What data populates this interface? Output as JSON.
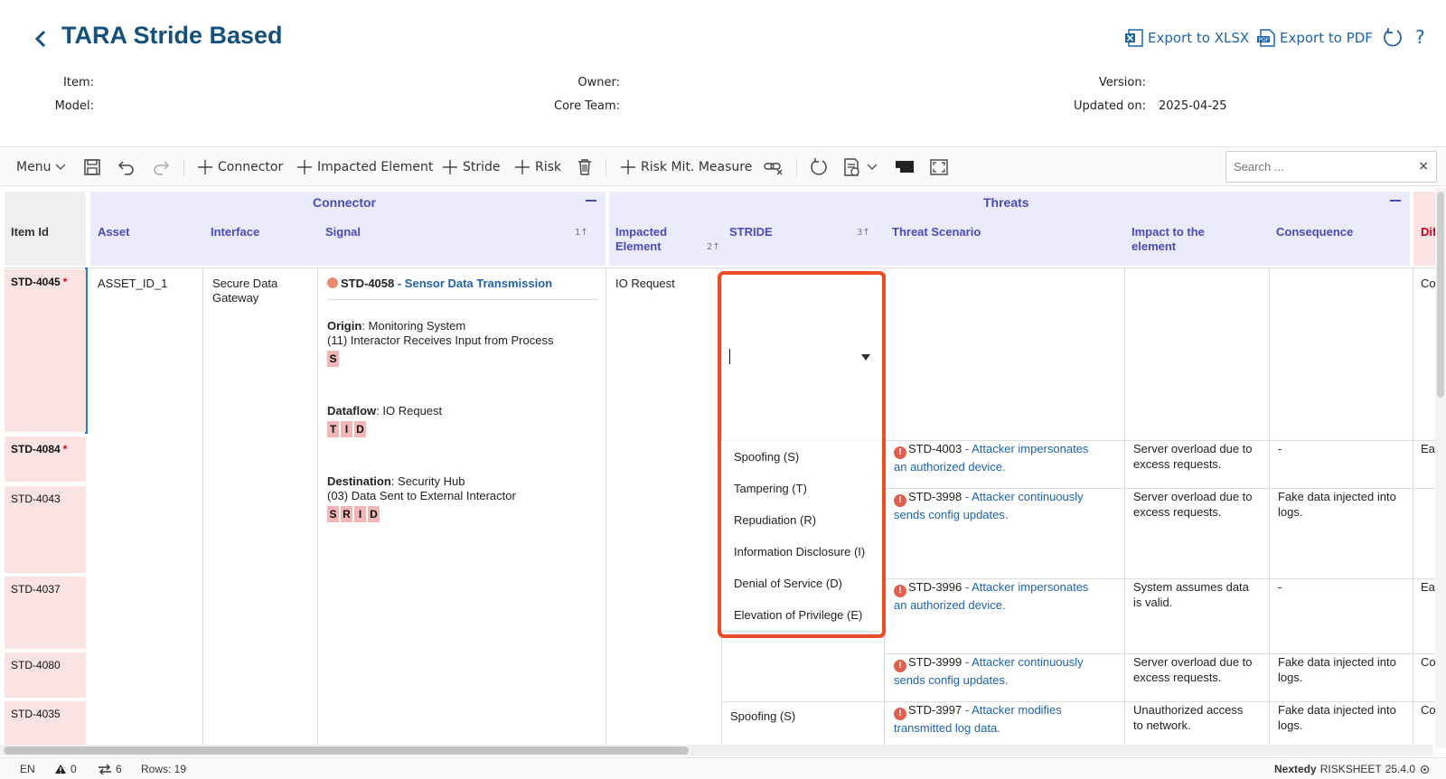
{
  "header": {
    "title": "TARA Stride Based",
    "export_xlsx": "Export to XLSX",
    "export_pdf": "Export to PDF",
    "help": "?"
  },
  "meta": {
    "item_label": "Item:",
    "model_label": "Model:",
    "owner_label": "Owner:",
    "core_team_label": "Core Team:",
    "version_label": "Version:",
    "updated_label": "Updated on:",
    "updated_value": "2025-04-25"
  },
  "toolbar": {
    "menu": "Menu",
    "connector": "Connector",
    "impacted_element": "Impacted Element",
    "stride": "Stride",
    "risk": "Risk",
    "risk_mit_measure": "Risk Mit. Measure",
    "search_placeholder": "Search ..."
  },
  "groups": {
    "connector": "Connector",
    "threats": "Threats"
  },
  "columns": {
    "item_id": "Item Id",
    "asset": "Asset",
    "interface": "Interface",
    "signal": "Signal",
    "signal_sort": "1↑",
    "impacted_element_1": "Impacted",
    "impacted_element_2": "Element",
    "impacted_sort": "2↑",
    "stride": "STRIDE",
    "stride_sort": "3↑",
    "threat_scenario": "Threat Scenario",
    "impact_1": "Impact to the",
    "impact_2": "element",
    "consequence": "Consequence",
    "difficulty": "Dif"
  },
  "rows": {
    "id_1": "STD-4045",
    "id_2": "STD-4084",
    "id_3": "STD-4043",
    "id_4": "STD-4037",
    "id_5": "STD-4080",
    "id_6": "STD-4035",
    "asset": "ASSET_ID_1",
    "interface_1": "Secure Data",
    "interface_2": "Gateway",
    "signal_id": "STD-4058",
    "signal_name": " - Sensor Data Transmission",
    "origin_label": "Origin",
    "origin_value": ": Monitoring System",
    "origin_detail": "(11) Interactor Receives Input from Process",
    "origin_badges": [
      "S"
    ],
    "dataflow_label": "Dataflow",
    "dataflow_value": ": IO Request",
    "dataflow_badges": [
      "T",
      "I",
      "D"
    ],
    "dest_label": "Destination",
    "dest_value": ": Security Hub",
    "dest_detail": "(03) Data Sent to External Interactor",
    "dest_badges": [
      "S",
      "R",
      "I",
      "D"
    ],
    "impacted": "IO Request",
    "stride_last": "Spoofing (S)",
    "difficulty_1": "Co",
    "threats": [
      {
        "id": "STD-4003",
        "text_1": " - Attacker impersonates",
        "text_2": "an authorized device.",
        "impact_1": "Server overload due to",
        "impact_2": "excess requests.",
        "consequence_1": "-",
        "consequence_2": "",
        "difficulty": "Eas"
      },
      {
        "id": "STD-3998",
        "text_1": " - Attacker continuously",
        "text_2": "sends config updates.",
        "impact_1": "Server overload due to",
        "impact_2": "excess requests.",
        "consequence_1": "Fake data injected into",
        "consequence_2": "logs.",
        "difficulty": ""
      },
      {
        "id": "STD-3996",
        "text_1": " - Attacker impersonates",
        "text_2": "an authorized device.",
        "impact_1": "System assumes data",
        "impact_2": "is valid.",
        "consequence_1": "-",
        "consequence_2": "",
        "difficulty": "Eas"
      },
      {
        "id": "STD-3999",
        "text_1": " - Attacker continuously",
        "text_2": "sends config updates.",
        "impact_1": "Server overload due to",
        "impact_2": "excess requests.",
        "consequence_1": "Fake data injected into",
        "consequence_2": "logs.",
        "difficulty": "Co"
      },
      {
        "id": "STD-3997",
        "text_1": " - Attacker modifies",
        "text_2": "transmitted log data.",
        "impact_1": "Unauthorized access",
        "impact_2": "to network.",
        "consequence_1": "Fake data injected into",
        "consequence_2": "logs.",
        "difficulty": "Co"
      }
    ]
  },
  "stride_dropdown": {
    "options": [
      "Spoofing (S)",
      "Tampering (T)",
      "Repudiation (R)",
      "Information Disclosure (I)",
      "Denial of Service (D)",
      "Elevation of Privilege (E)"
    ]
  },
  "status": {
    "lang": "EN",
    "warnings": "0",
    "links": "6",
    "rows": "Rows: 19",
    "brand": "Nextedy",
    "product": "RISKSHEET",
    "version": "25.4.0"
  },
  "colors": {
    "accent": "#15507c",
    "link": "#1f63a6",
    "header_group": "#ebebfb",
    "id_cell": "#fbe3e3",
    "highlight": "#ee4b26"
  }
}
